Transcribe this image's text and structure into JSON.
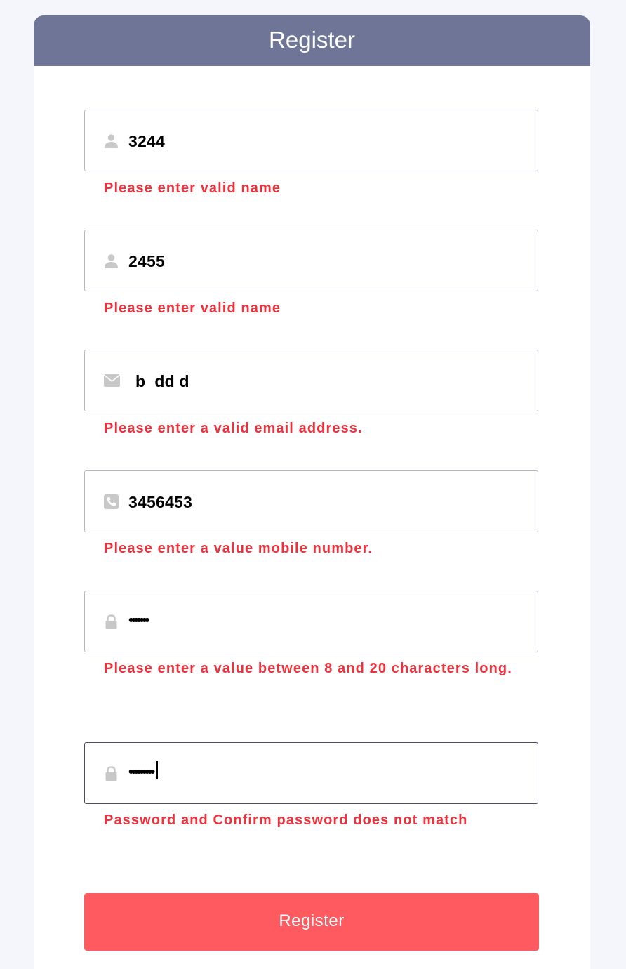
{
  "header": {
    "title": "Register"
  },
  "form": {
    "first_name": {
      "value": "3244",
      "icon": "user-icon",
      "error": "Please enter valid name"
    },
    "last_name": {
      "value": "2455",
      "icon": "user-icon",
      "error": "Please enter valid name"
    },
    "email": {
      "value": "b  dd d",
      "icon": "envelope-icon",
      "error": "Please enter a valid email address."
    },
    "mobile": {
      "value": "3456453",
      "icon": "phone-icon",
      "error": "Please enter a value mobile number."
    },
    "password": {
      "value": "•••••••",
      "icon": "lock-icon",
      "error": "Please enter a value between 8 and 20 characters long."
    },
    "confirm_password": {
      "value": "•••••••••",
      "icon": "lock-icon",
      "error": "Password and Confirm password does not match"
    },
    "submit_label": "Register"
  },
  "colors": {
    "header_bg": "#6e7596",
    "error": "#f0303a",
    "button_bg": "#fe5a60",
    "icon": "#c8c8c8"
  }
}
